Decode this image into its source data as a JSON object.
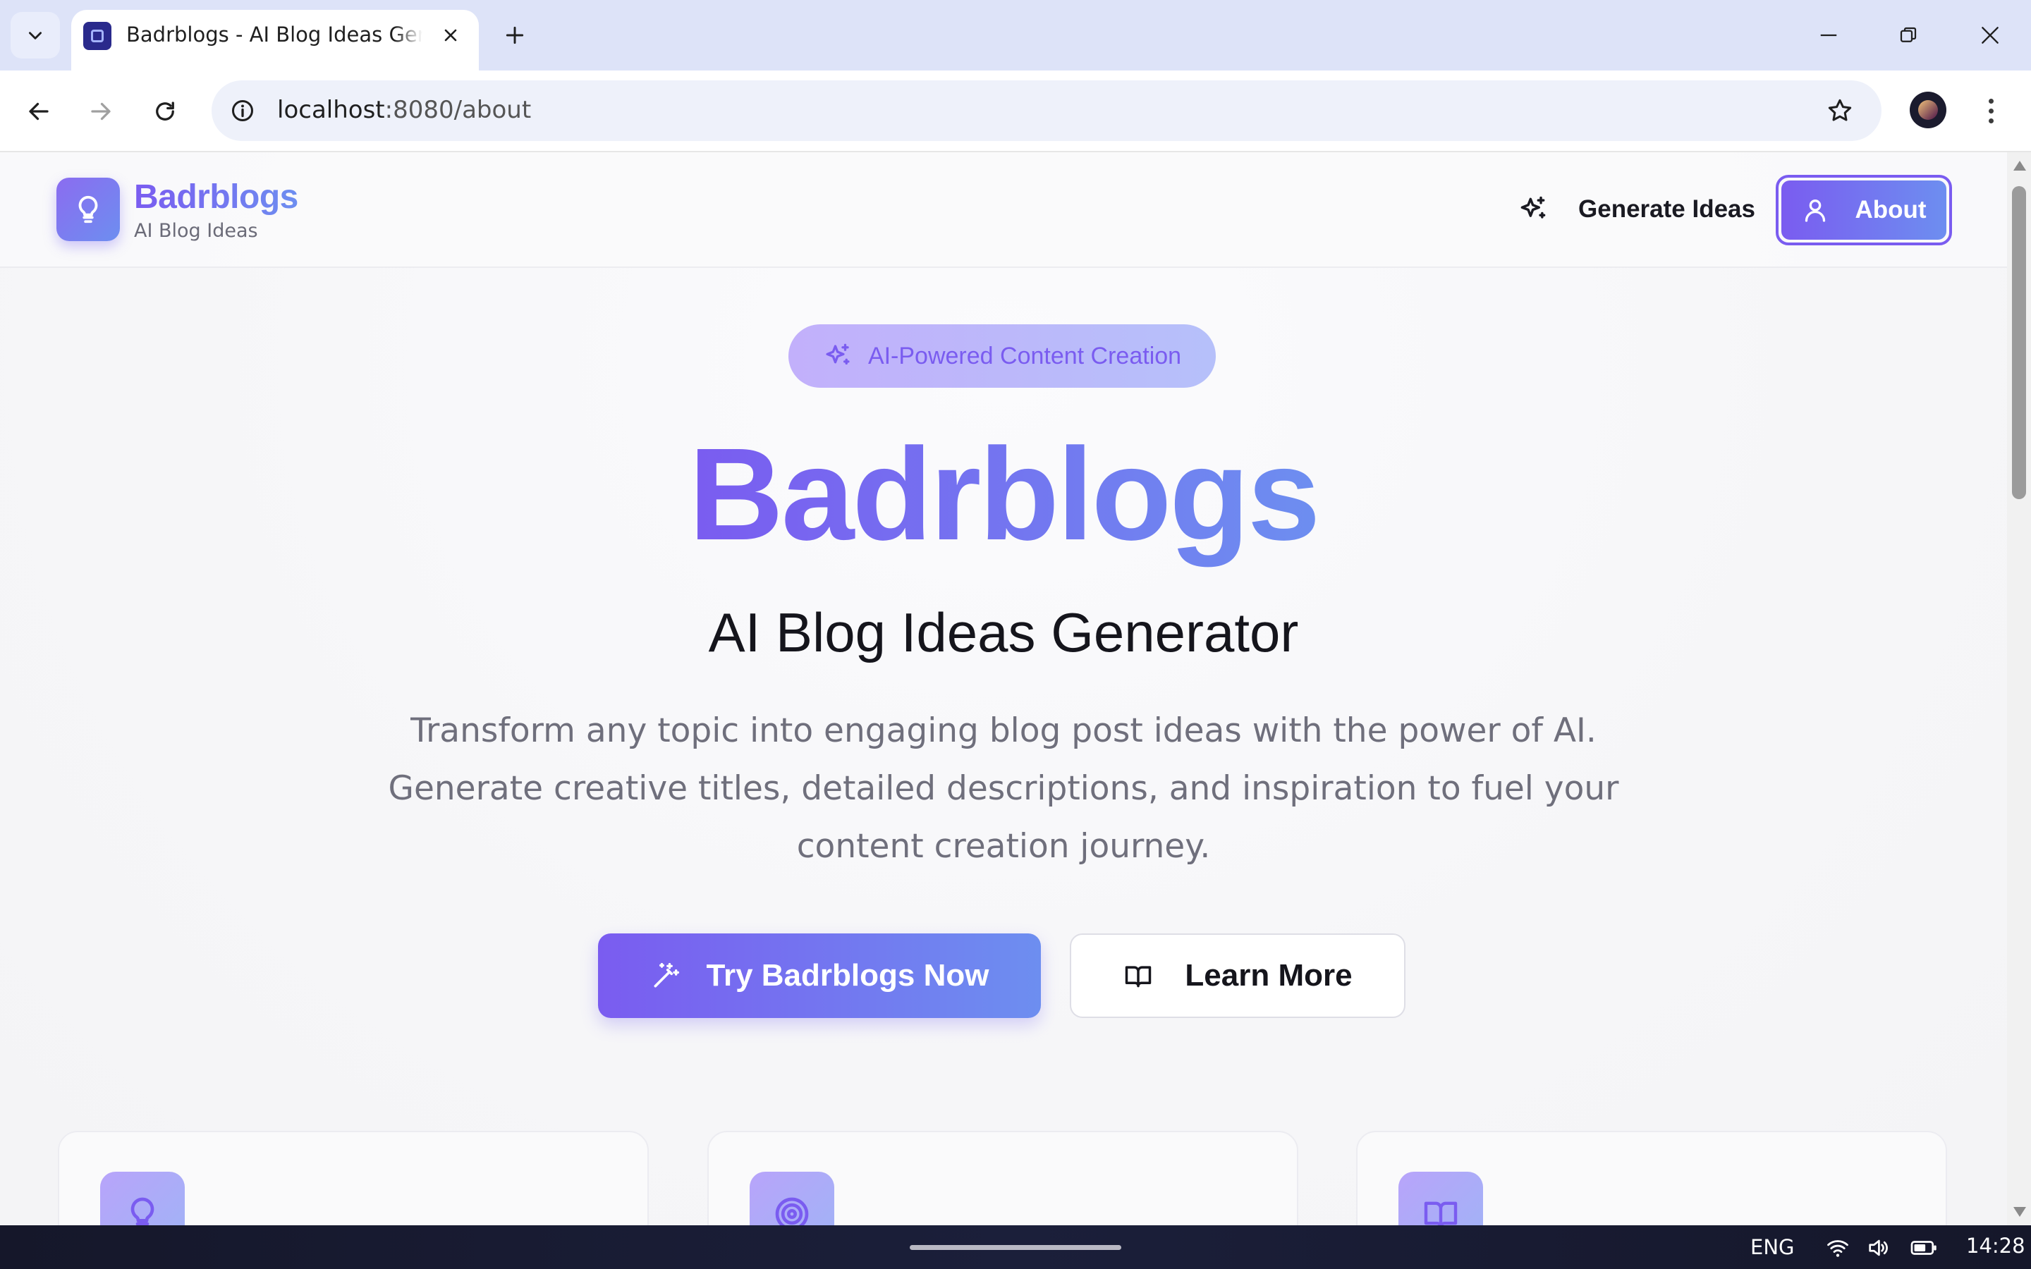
{
  "browser": {
    "tab": {
      "title": "Badrblogs - AI Blog Ideas Generator",
      "favicon": "bulb-favicon"
    },
    "address_bar": {
      "host": "localhost",
      "path": ":8080/about"
    },
    "icons": {
      "tab_search": "chevron-down-icon",
      "close_tab": "close-icon",
      "new_tab": "plus-icon",
      "minimize": "minimize-icon",
      "restore": "restore-icon",
      "close_window": "close-icon",
      "back": "arrow-left-icon",
      "forward": "arrow-right-icon",
      "reload": "reload-icon",
      "site_info": "info-icon",
      "bookmark": "star-icon",
      "profile": "avatar",
      "menu": "kebab-menu-icon"
    }
  },
  "site": {
    "brand": {
      "name": "Badrblogs",
      "tagline": "AI Blog Ideas"
    },
    "nav": {
      "generate_label": "Generate Ideas",
      "about_label": "About",
      "active": "About"
    },
    "hero": {
      "badge": "AI-Powered Content Creation",
      "title": "Badrblogs",
      "subtitle": "AI Blog Ideas Generator",
      "description": "Transform any topic into engaging blog post ideas with the power of AI. Generate creative titles, detailed descriptions, and inspiration to fuel your content creation journey.",
      "primary_cta": "Try Badrblogs Now",
      "secondary_cta": "Learn More"
    },
    "feature_cards": [
      {
        "icon": "bulb-icon"
      },
      {
        "icon": "target-icon"
      },
      {
        "icon": "book-open-icon"
      }
    ],
    "colors": {
      "accent_start": "#7a5cf0",
      "accent_end": "#6d8ef0",
      "text_dark": "#15151c",
      "text_muted": "#6f6f7c"
    }
  },
  "taskbar": {
    "language": "ENG",
    "time": "14:28",
    "icons": [
      "wifi-icon",
      "volume-icon",
      "battery-icon"
    ]
  }
}
